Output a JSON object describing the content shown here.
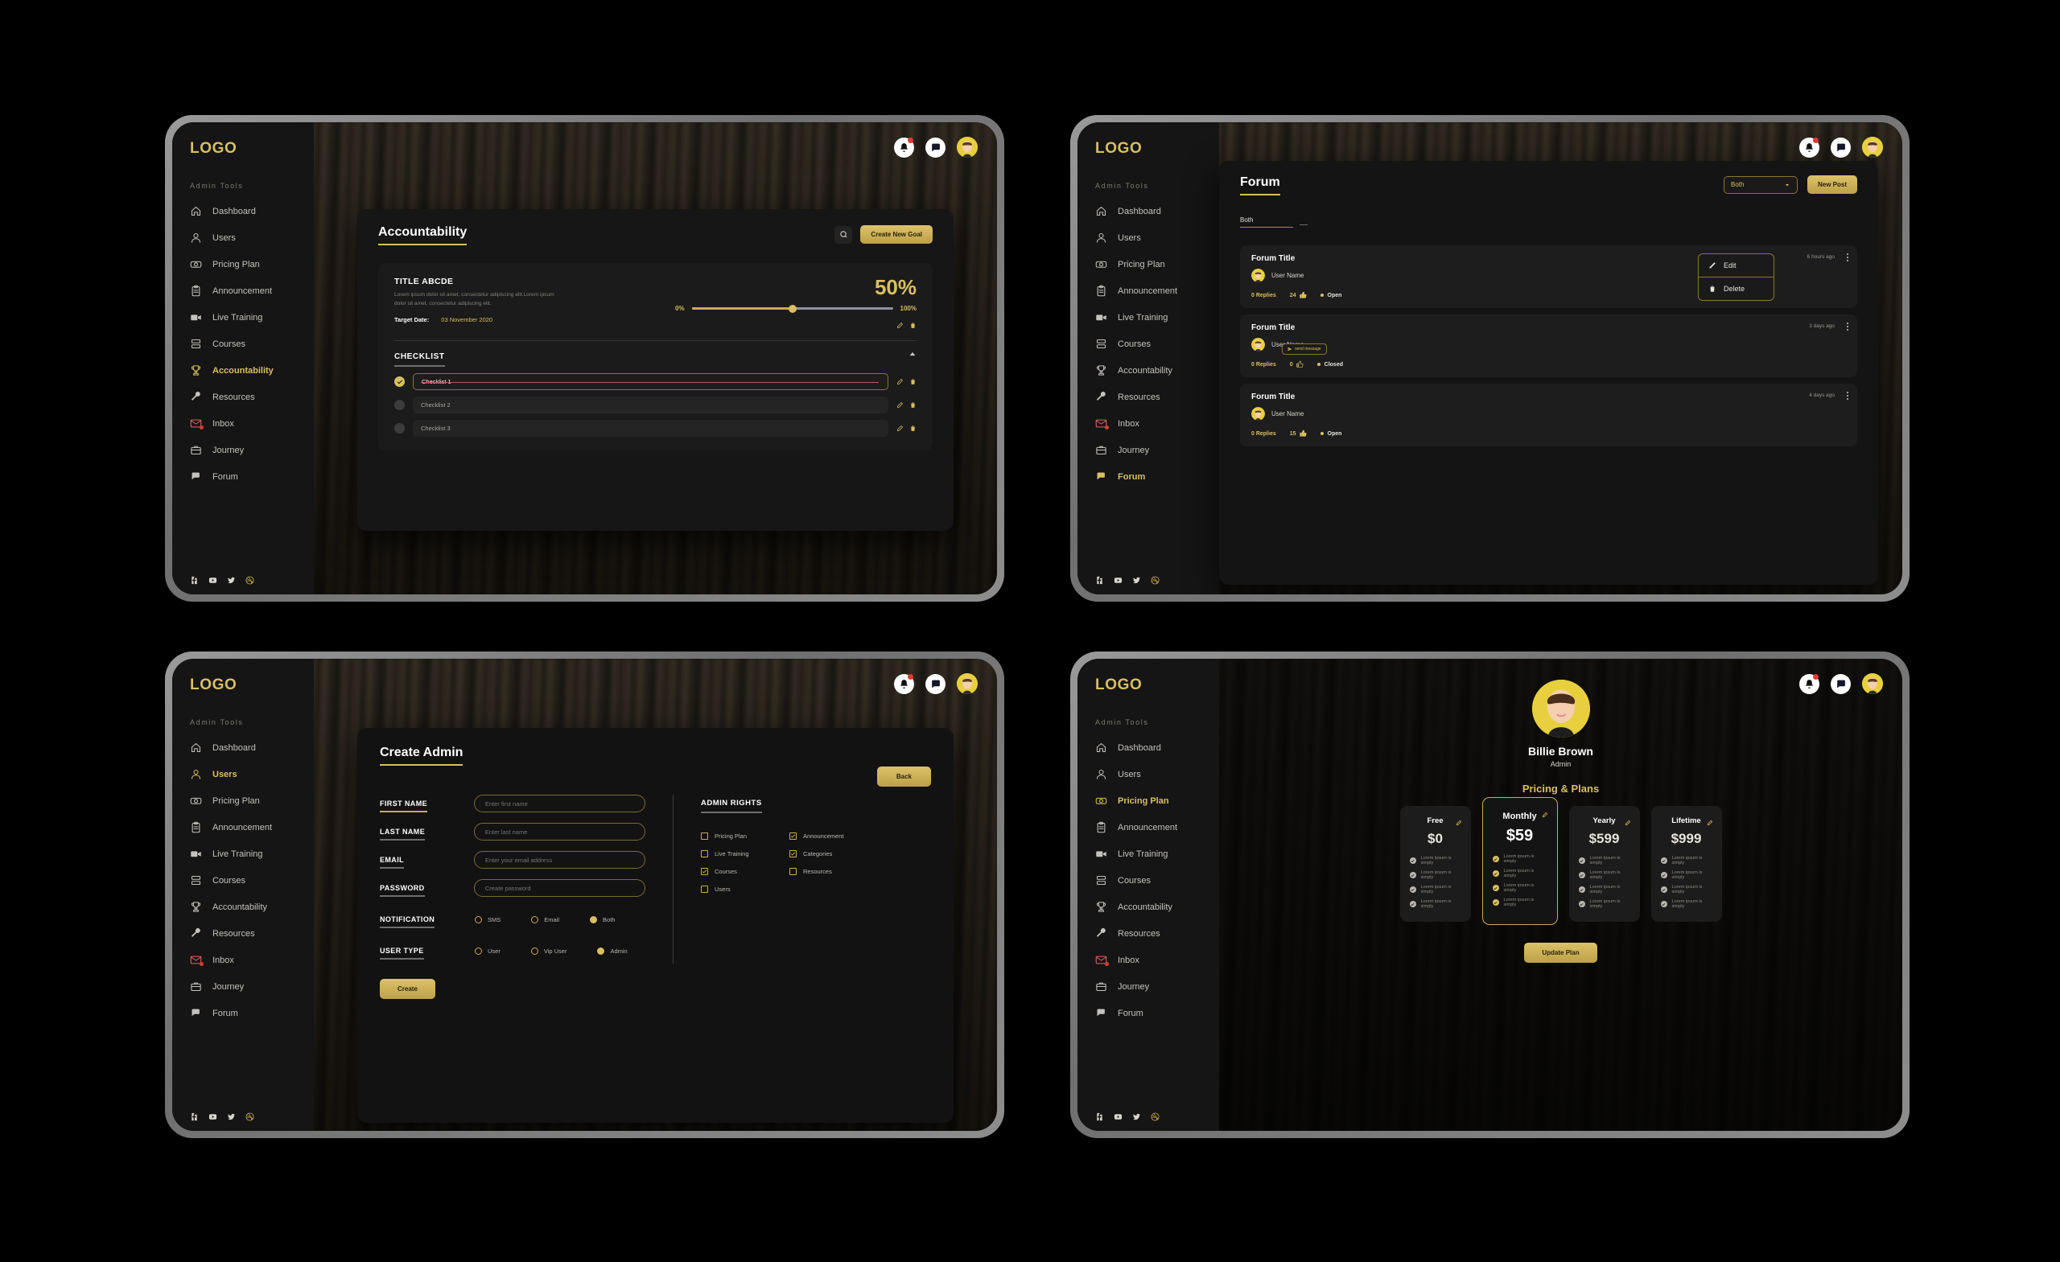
{
  "brand": {
    "logo": "LOGO",
    "accent": "#d9bf61",
    "gold_dark": "#c9ad4f",
    "danger": "#e03a2f"
  },
  "sidebar": {
    "heading": "Admin Tools",
    "items": [
      {
        "label": "Dashboard",
        "icon": "home-icon"
      },
      {
        "label": "Users",
        "icon": "user-icon"
      },
      {
        "label": "Pricing Plan",
        "icon": "money-icon"
      },
      {
        "label": "Announcement",
        "icon": "clipboard-icon"
      },
      {
        "label": "Live Training",
        "icon": "video-camera-icon"
      },
      {
        "label": "Courses",
        "icon": "layers-icon"
      },
      {
        "label": "Accountability",
        "icon": "trophy-icon"
      },
      {
        "label": "Resources",
        "icon": "wrench-icon"
      },
      {
        "label": "Inbox",
        "icon": "envelope-icon",
        "badge": true
      },
      {
        "label": "Journey",
        "icon": "briefcase-icon"
      },
      {
        "label": "Forum",
        "icon": "chat-icon"
      }
    ],
    "social": [
      "facebook-icon",
      "youtube-icon",
      "twitter-icon",
      "dribbble-icon"
    ]
  },
  "header": {
    "icons": [
      "bell-icon",
      "message-icon",
      "avatar"
    ]
  },
  "screens": {
    "accountability": {
      "active_nav": "Accountability",
      "title": "Accountability",
      "search_icon": "search-icon",
      "create_goal_label": "Create New Goal",
      "goal": {
        "title": "TITLE ABCDE",
        "description": "Lorem ipsum dolor sit amet, consectetur adipiscing elit.Lorem ipsum dolor sit amet, consectetur adipiscing elit.",
        "target_date_label": "Target Date:",
        "target_date": "03 November 2020",
        "percent_label": "50%",
        "percent": 50,
        "slider_min_label": "0%",
        "slider_max_label": "100%"
      },
      "checklist_heading": "CHECKLIST",
      "checklist": [
        {
          "text": "Checklist 1",
          "done": true
        },
        {
          "text": "Checklist 2",
          "done": false
        },
        {
          "text": "Checklist 3",
          "done": false
        }
      ]
    },
    "forum": {
      "active_nav": "Forum",
      "title": "Forum",
      "filter_selected": "Both",
      "filter_chip": "Both",
      "new_post_label": "New Post",
      "posts": [
        {
          "title": "Forum Title",
          "user": "User Name",
          "ago": "6 hours ago",
          "replies": "0 Replies",
          "likes": "24",
          "status": "Open"
        },
        {
          "title": "Forum Title",
          "user": "User Name",
          "ago": "3 days ago",
          "replies": "0 Replies",
          "likes": "0",
          "status": "Closed",
          "tooltip": "send message"
        },
        {
          "title": "Forum Title",
          "user": "User Name",
          "ago": "4 days ago",
          "replies": "0 Replies",
          "likes": "15",
          "status": "Open"
        }
      ],
      "menu": {
        "edit": "Edit",
        "delete": "Delete"
      }
    },
    "create_admin": {
      "active_nav": "Users",
      "title": "Create Admin",
      "back_label": "Back",
      "create_label": "Create",
      "fields": [
        {
          "label": "FIRST NAME",
          "placeholder": "Enter first name",
          "value": ""
        },
        {
          "label": "LAST NAME",
          "placeholder": "Enter last name",
          "value": ""
        },
        {
          "label": "EMAIL",
          "placeholder": "Enter your email address",
          "value": ""
        },
        {
          "label": "PASSWORD",
          "placeholder": "Create password",
          "value": ""
        }
      ],
      "notification": {
        "label": "NOTIFICATION",
        "options": [
          {
            "label": "SMS",
            "selected": false
          },
          {
            "label": "Email",
            "selected": false
          },
          {
            "label": "Both",
            "selected": true
          }
        ]
      },
      "user_type": {
        "label": "USER TYPE",
        "options": [
          {
            "label": "User",
            "selected": false
          },
          {
            "label": "Vip User",
            "selected": false
          },
          {
            "label": "Admin",
            "selected": true
          }
        ]
      },
      "admin_rights": {
        "label": "ADMIN RIGHTS",
        "options": [
          {
            "label": "Pricing Plan",
            "checked": false
          },
          {
            "label": "Announcement",
            "checked": true
          },
          {
            "label": "Live Training",
            "checked": false
          },
          {
            "label": "Categories",
            "checked": true
          },
          {
            "label": "Courses",
            "checked": true
          },
          {
            "label": "Resources",
            "checked": false
          },
          {
            "label": "Users",
            "checked": false
          }
        ]
      }
    },
    "pricing": {
      "active_nav": "Pricing Plan",
      "profile_name": "Billie Brown",
      "profile_role": "Admin",
      "section_title": "Pricing & Plans",
      "update_label": "Update Plan",
      "feature_text": "Lorem ipsum is simply",
      "plans": [
        {
          "name": "Free",
          "price": "$0",
          "features": 4,
          "highlight": false
        },
        {
          "name": "Monthly",
          "price": "$59",
          "features": 4,
          "highlight": true
        },
        {
          "name": "Yearly",
          "price": "$599",
          "features": 4,
          "highlight": false
        },
        {
          "name": "Lifetime",
          "price": "$999",
          "features": 4,
          "highlight": false
        }
      ]
    }
  }
}
